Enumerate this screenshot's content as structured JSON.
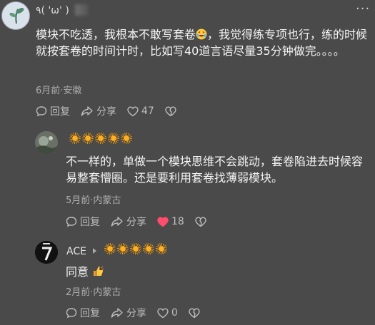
{
  "comments": [
    {
      "username": "٩( 'ω' )",
      "text": "模块不吃透，我根本不敢写套卷",
      "text_after_emoji": "，我觉得练专项也行，练的时候就按套卷的时间计时，比如写40道言语尽量35分钟做完。。。。",
      "meta": "6月前·安徽",
      "reply_label": "回复",
      "share_label": "分享",
      "likes": "47",
      "liked": false
    },
    {
      "username": "",
      "text": "不一样的，单做一个模块思维不会跳动，套卷陷进去时候容易整套懵圈。还是要利用套卷找薄弱模块。",
      "meta": "5月前·内蒙古",
      "reply_label": "回复",
      "share_label": "分享",
      "likes": "18",
      "liked": true
    },
    {
      "username": "ACE",
      "text": "同意",
      "meta": "2月前·内蒙古",
      "reply_label": "回复",
      "share_label": "分享",
      "likes": "0",
      "liked": false
    }
  ],
  "icons": {
    "reply": "comment-bubble-icon",
    "share": "share-arrow-icon",
    "like": "heart-icon",
    "dislike": "broken-heart-icon",
    "more": "more-dots-icon"
  },
  "colors": {
    "background": "#4a4a4a",
    "liked_heart": "#ff4d6d",
    "sun": "#f59a00"
  }
}
